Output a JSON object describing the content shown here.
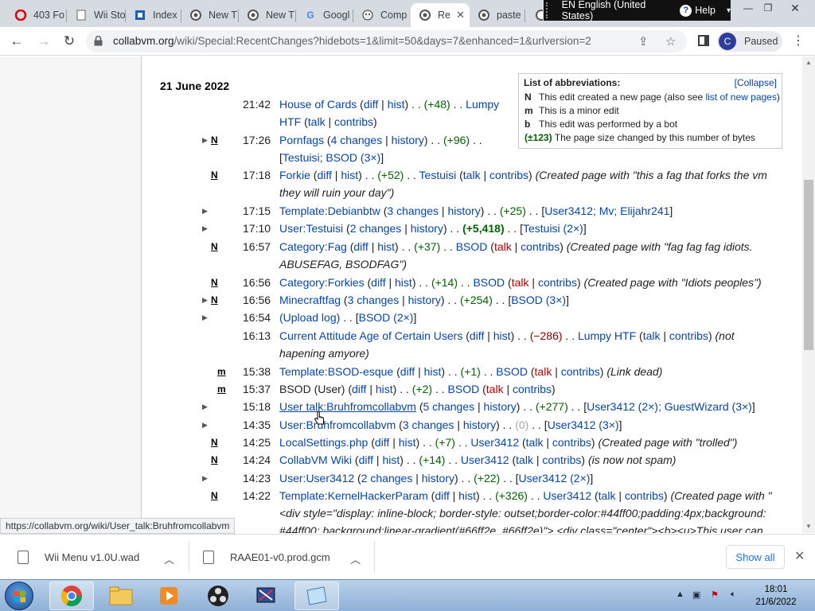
{
  "browser": {
    "tabs": [
      {
        "label": "403 Fo",
        "icon": "opera-icon"
      },
      {
        "label": "Wii Sto",
        "icon": "page-icon"
      },
      {
        "label": "Index",
        "icon": "index-icon"
      },
      {
        "label": "New T",
        "icon": "chrome-icon"
      },
      {
        "label": "New T",
        "icon": "chrome-icon"
      },
      {
        "label": "Googl",
        "icon": "google-icon"
      },
      {
        "label": "Comp",
        "icon": "collabvm-icon"
      },
      {
        "label": "Re",
        "icon": "chrome-icon",
        "active": true
      },
      {
        "label": "paste",
        "icon": "chrome-icon"
      }
    ],
    "language_bar": {
      "language": "EN English (United States)",
      "help": "Help"
    },
    "url_host": "collabvm.org",
    "url_path": "/wiki/Special:RecentChanges?hidebots=1&limit=50&days=7&enhanced=1&urlversion=2",
    "profile": {
      "initial": "C",
      "status": "Paused"
    },
    "status_url": "https://collabvm.org/wiki/User_talk:Bruhfromcollabvm"
  },
  "wiki": {
    "day_heading": "21 June 2022",
    "abbreviations": {
      "title": "List of abbreviations:",
      "collapse": "[Collapse]",
      "rows": [
        {
          "key": "N",
          "text": "This edit created a new page (also see ",
          "link": "list of new pages",
          "after": ")"
        },
        {
          "key": "m",
          "text": "This is a minor edit"
        },
        {
          "key": "b",
          "text": "This edit was performed by a bot"
        },
        {
          "key": "(±123)",
          "text": "The page size changed by this number of bytes"
        }
      ]
    },
    "changes": [
      {
        "time": "21:42",
        "title": "House of Cards",
        "size": "(+48)",
        "user": "Lumpy HTF",
        "flag": ""
      },
      {
        "time": "17:26",
        "title": "Pornfags",
        "changes": "4 changes",
        "size": "(+96)",
        "users": "Testuisi; BSOD (3×)",
        "flag": "N"
      },
      {
        "time": "17:18",
        "title": "Forkie",
        "size": "(+52)",
        "user": "Testuisi",
        "comment": "(Created page with \"this a fag that forks the vm they will ruin your day\")",
        "flag": "N"
      },
      {
        "time": "17:15",
        "title": "Template:Debianbtw",
        "changes": "3 changes",
        "size": "(+25)",
        "users": "User3412; Mv; Elijahr241"
      },
      {
        "time": "17:10",
        "title": "User:Testuisi",
        "changes": "2 changes",
        "size": "(+5,418)",
        "users": "Testuisi (2×)"
      },
      {
        "time": "16:57",
        "title": "Category:Fag",
        "size": "(+37)",
        "user": "BSOD",
        "comment": "(Created page with \"fag fag fag idiots. ABUSEFAG, BSODFAG\")",
        "flag": "N"
      },
      {
        "time": "16:56",
        "title": "Category:Forkies",
        "size": "(+14)",
        "user": "BSOD",
        "comment": "(Created page with \"Idiots peoples\")",
        "flag": "N"
      },
      {
        "time": "16:56",
        "title": "Minecraftfag",
        "changes": "3 changes",
        "size": "(+254)",
        "users": "BSOD (3×)",
        "flag": "N"
      },
      {
        "time": "16:54",
        "title": "(Upload log)",
        "users": "BSOD (2×)"
      },
      {
        "time": "16:13",
        "title": "Current Attitude Age of Certain Users",
        "size": "(−286)",
        "user": "Lumpy HTF",
        "comment": "(not hapening amyore)"
      },
      {
        "time": "15:38",
        "title": "Template:BSOD-esque",
        "size": "(+1)",
        "user": "BSOD",
        "comment": "(Link dead)",
        "flag": "m"
      },
      {
        "time": "15:37",
        "title": "BSOD (User)",
        "size": "(+2)",
        "user": "BSOD",
        "flag": "m"
      },
      {
        "time": "15:18",
        "title": "User talk:Bruhfromcollabvm",
        "changes": "5 changes",
        "size": "(+277)",
        "users": "User3412 (2×); GuestWizard (3×)"
      },
      {
        "time": "14:35",
        "title": "User:Bruhfromcollabvm",
        "changes": "3 changes",
        "size": "(0)",
        "users": "User3412 (3×)"
      },
      {
        "time": "14:25",
        "title": "LocalSettings.php",
        "size": "(+7)",
        "user": "User3412",
        "comment": "(Created page with \"trolled\")",
        "flag": "N"
      },
      {
        "time": "14:24",
        "title": "CollabVM Wiki",
        "size": "(+14)",
        "user": "User3412",
        "comment": "(is now not spam)",
        "flag": "N"
      },
      {
        "time": "14:23",
        "title": "User:User3412",
        "changes": "2 changes",
        "size": "(+22)",
        "users": "User3412 (2×)"
      },
      {
        "time": "14:22",
        "title": "Template:KernelHackerParam",
        "size": "(+326)",
        "user": "User3412",
        "comment": "(Created page with \"<div style=\"display: inline-block; border-style: outset;border-color:#44ff00;padding:4px;background: #44ff00; background:linear-gradient(#66ff2e, #66ff2e)\"> <div class=\"center\"><b><u>This user can",
        "flag": "N"
      }
    ],
    "link_words": {
      "diff": "diff",
      "hist": "hist",
      "history": "history",
      "talk": "talk",
      "contribs": "contribs",
      "sep": ". ."
    }
  },
  "downloads": [
    {
      "name": "Wii Menu v1.0U.wad"
    },
    {
      "name": "RAAE01-v0.prod.gcm"
    }
  ],
  "show_all": "Show all",
  "taskbar": {
    "time": "18:01",
    "date": "21/6/2022"
  },
  "colors": {
    "link": "#0645ad",
    "red_link": "#ba0000",
    "positive": "#006400",
    "negative": "#8b0000",
    "taskbar": "#8fb1d6"
  }
}
